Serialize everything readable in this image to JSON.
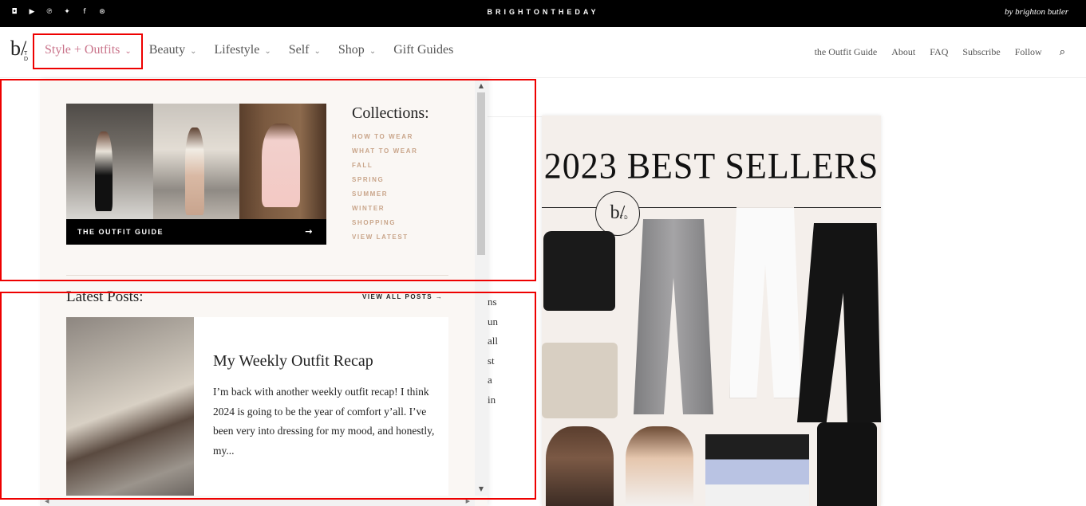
{
  "topbar": {
    "brand": "BRIGHTONTHEDAY",
    "byline": "by brighton butler",
    "social_icons": [
      "instagram-icon",
      "youtube-icon",
      "pinterest-icon",
      "twitter-icon",
      "facebook-icon",
      "ltk-icon"
    ]
  },
  "nav": {
    "logo": "b/",
    "logo_sub": "T D",
    "menu": [
      {
        "label": "Style + Outfits",
        "chevron": "⌄",
        "active": true
      },
      {
        "label": "Beauty",
        "chevron": "⌄"
      },
      {
        "label": "Lifestyle",
        "chevron": "⌄"
      },
      {
        "label": "Self",
        "chevron": "⌄"
      },
      {
        "label": "Shop",
        "chevron": "⌄"
      },
      {
        "label": "Gift Guides"
      }
    ],
    "right_links": [
      "the Outfit Guide",
      "About",
      "FAQ",
      "Subscribe",
      "Follow"
    ],
    "search_icon": "⌕",
    "active_color": "#c9738a"
  },
  "dropdown": {
    "outfit_guide_label": "THE OUTFIT GUIDE",
    "arrow": "→",
    "collections_title": "Collections:",
    "collections": [
      "HOW TO WEAR",
      "WHAT TO WEAR",
      "FALL",
      "SPRING",
      "SUMMER",
      "WINTER",
      "SHOPPING",
      "VIEW LATEST"
    ],
    "latest_title": "Latest Posts:",
    "view_all": "VIEW ALL POSTS →",
    "post": {
      "title": "My Weekly Outfit Recap",
      "excerpt": "I’m back with another weekly outfit recap! I think 2024 is going to be the year of comfort y’all. I’ve been very into dressing for my mood, and honestly, my..."
    },
    "scroll_up": "▲",
    "scroll_down": "▼",
    "hscroll_left": "◀",
    "hscroll_right": "▶"
  },
  "background": {
    "text_fragments": [
      "ns",
      "un",
      "all",
      "st",
      "a",
      "in"
    ],
    "ad_title": "2023 BEST SELLERS",
    "ad_logo": "b/",
    "ad_logo_sub": "T D"
  },
  "colors": {
    "accent": "#c9738a",
    "collection_link": "#c9a58a",
    "highlight": "#e00000"
  }
}
